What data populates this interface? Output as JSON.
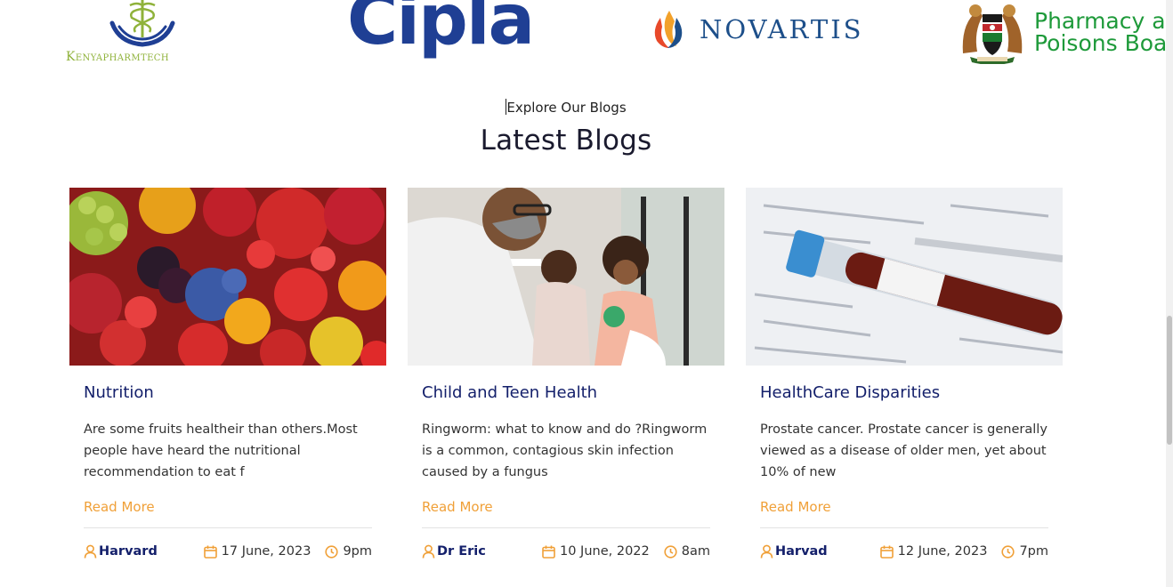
{
  "partners": [
    {
      "name": "Kenyapharmtech",
      "icon": "caduceus-hands-logo"
    },
    {
      "name": "Cipla"
    },
    {
      "name": "NOVARTIS",
      "icon": "flame-logo"
    },
    {
      "name_lines": [
        "Pharmacy a",
        "Poisons Boa"
      ],
      "icon": "kenya-coat-of-arms"
    }
  ],
  "section": {
    "kicker": "Explore Our Blogs",
    "title": "Latest Blogs"
  },
  "blogs": [
    {
      "image": "fruits-photo",
      "title": "Nutrition",
      "excerpt": "Are some fruits healtheir than others.Most people have heard the nutritional recommendation to eat f",
      "read_more": "Read More",
      "author": "Harvard",
      "date": "17 June, 2023",
      "time": "9pm"
    },
    {
      "image": "doctor-child-photo",
      "title": "Child and Teen Health",
      "excerpt": "Ringworm: what to know and do ?Ringworm is a common, contagious skin infection caused by a fungus",
      "read_more": "Read More",
      "author": "Dr Eric",
      "date": "10 June, 2022",
      "time": "8am"
    },
    {
      "image": "blood-test-tube-photo",
      "title": "HealthCare Disparities",
      "excerpt": "Prostate cancer. Prostate cancer is generally viewed as a disease of older men, yet about 10% of new",
      "read_more": "Read More",
      "author": "Harvad",
      "date": "12 June, 2023",
      "time": "7pm"
    }
  ],
  "colors": {
    "accent": "#f0a038",
    "navy": "#14206b",
    "cipla_blue": "#1f3f94",
    "novartis_blue": "#1d4f8a",
    "ppb_green": "#1e9a3a",
    "kenya_green": "#8fb23a"
  }
}
